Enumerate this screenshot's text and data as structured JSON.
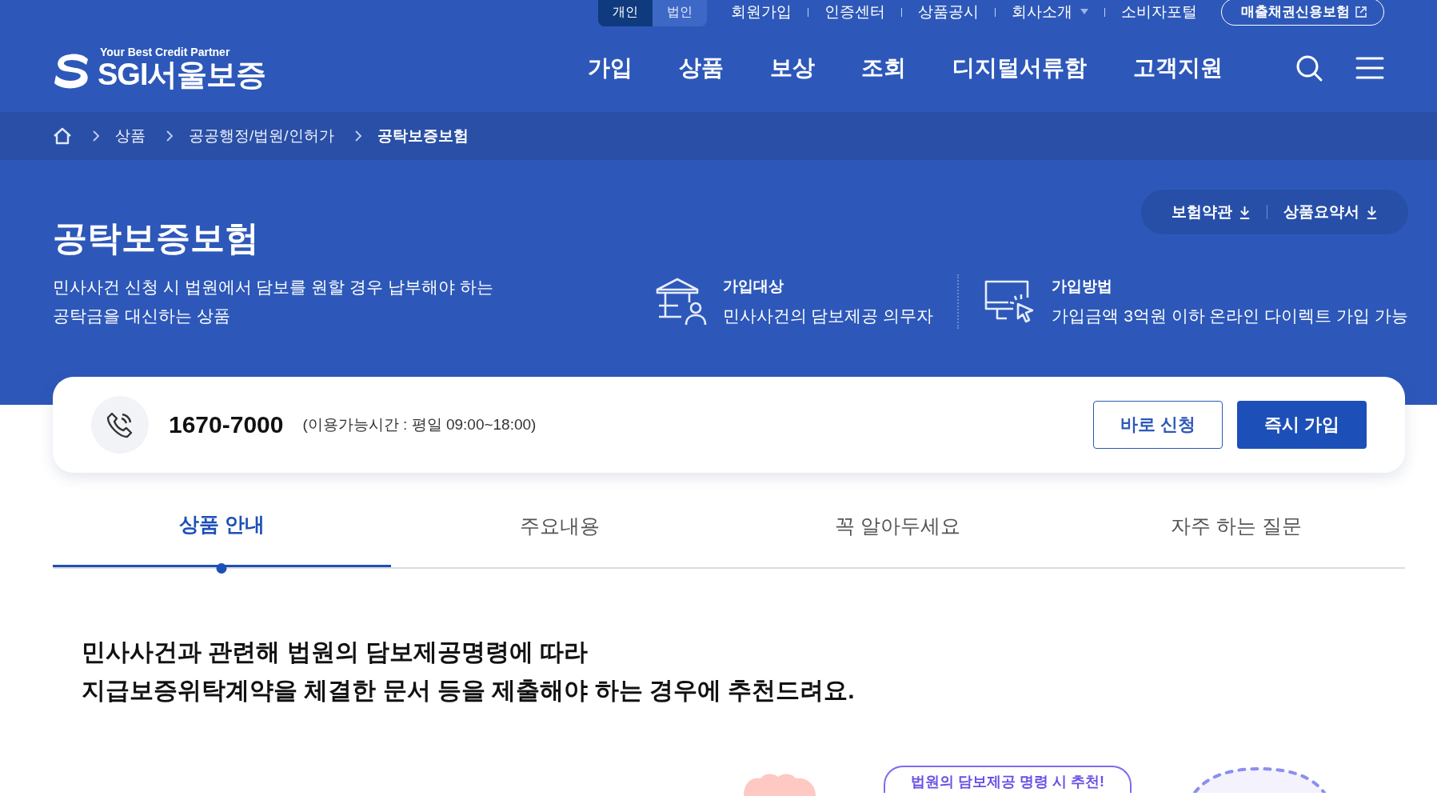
{
  "top_bar": {
    "segments": [
      {
        "label": "개인",
        "selected": true
      },
      {
        "label": "법인",
        "selected": false
      }
    ],
    "links": [
      {
        "label": "회원가입",
        "kind": "link"
      },
      {
        "label": "인증센터",
        "kind": "link"
      },
      {
        "label": "상품공시",
        "kind": "link"
      },
      {
        "label": "회사소개",
        "kind": "dropdown"
      },
      {
        "label": "소비자포털",
        "kind": "link"
      }
    ],
    "external_button": "매출채권신용보험"
  },
  "logo": {
    "tagline": "Your Best Credit Partner",
    "name": "SGI서울보증"
  },
  "nav": [
    "가입",
    "상품",
    "보상",
    "조회",
    "디지털서류함",
    "고객지원"
  ],
  "breadcrumb": [
    "상품",
    "공공행정/법원/인허가",
    "공탁보증보험"
  ],
  "hero": {
    "title": "공탁보증보험",
    "description": [
      "민사사건 신청 시 법원에서 담보를 원할 경우 납부해야 하는",
      "공탁금을 대신하는 상품"
    ],
    "downloads": [
      "보험약관",
      "상품요약서"
    ],
    "info": [
      {
        "kind": "target",
        "label": "가입대상",
        "text": "민사사건의 담보제공 의무자"
      },
      {
        "kind": "method",
        "label": "가입방법",
        "text": "가입금액 3억원 이하 온라인 다이렉트 가입 가능"
      }
    ]
  },
  "contact": {
    "phone": "1670-7000",
    "hours": "(이용가능시간 : 평일 09:00~18:00)",
    "buttons": [
      {
        "label": "바로 신청",
        "kind": "outline"
      },
      {
        "label": "즉시 가입",
        "kind": "primary"
      }
    ]
  },
  "tabs": [
    {
      "label": "상품 안내",
      "selected": true
    },
    {
      "label": "주요내용",
      "selected": false
    },
    {
      "label": "꼭 알아두세요",
      "selected": false
    },
    {
      "label": "자주 하는 질문",
      "selected": false
    }
  ],
  "intro": [
    "민사사건과 관련해 법원의 담보제공명령에 따라",
    "지급보증위탁계약을 체결한 문서 등을 제출해야 하는 경우에 추천드려요."
  ],
  "bubble": "법원의 담보제공 명령 시 추천!"
}
